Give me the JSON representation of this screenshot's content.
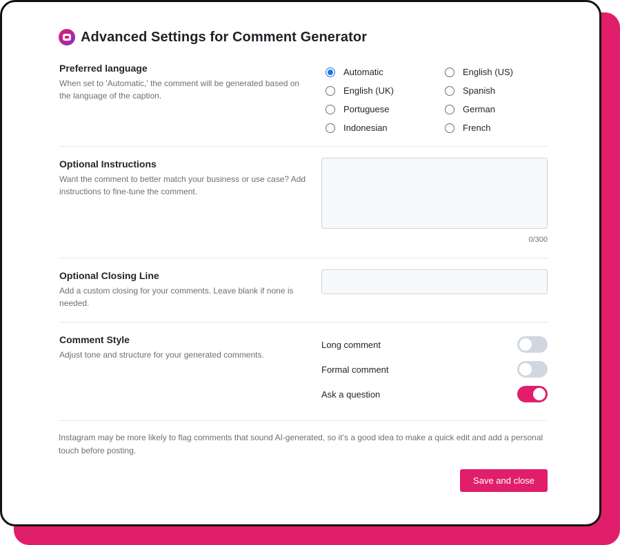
{
  "header": {
    "title": "Advanced Settings for Comment Generator",
    "icon": "comment-app-icon"
  },
  "language": {
    "title": "Preferred language",
    "description": "When set to 'Automatic,' the comment will be generated based on the language of the caption.",
    "options": [
      {
        "label": "Automatic",
        "checked": true
      },
      {
        "label": "English (US)",
        "checked": false
      },
      {
        "label": "English (UK)",
        "checked": false
      },
      {
        "label": "Spanish",
        "checked": false
      },
      {
        "label": "Portuguese",
        "checked": false
      },
      {
        "label": "German",
        "checked": false
      },
      {
        "label": "Indonesian",
        "checked": false
      },
      {
        "label": "French",
        "checked": false
      }
    ]
  },
  "instructions": {
    "title": "Optional Instructions",
    "description": "Want the comment to better match your business or use case? Add instructions to fine-tune the comment.",
    "value": "",
    "char_count": "0/300"
  },
  "closing": {
    "title": "Optional Closing Line",
    "description": "Add a custom closing for your comments. Leave blank if none is needed.",
    "value": ""
  },
  "style": {
    "title": "Comment Style",
    "description": "Adjust tone and structure for your generated comments.",
    "toggles": [
      {
        "label": "Long comment",
        "on": false
      },
      {
        "label": "Formal comment",
        "on": false
      },
      {
        "label": "Ask a question",
        "on": true
      }
    ]
  },
  "footer": {
    "note": "Instagram may be more likely to flag comments that sound AI-generated, so it’s a good idea to make a quick edit and add a personal touch before posting.",
    "save_label": "Save and close"
  },
  "colors": {
    "accent": "#e01e6b",
    "radio": "#1a73e8",
    "border": "#121212"
  }
}
